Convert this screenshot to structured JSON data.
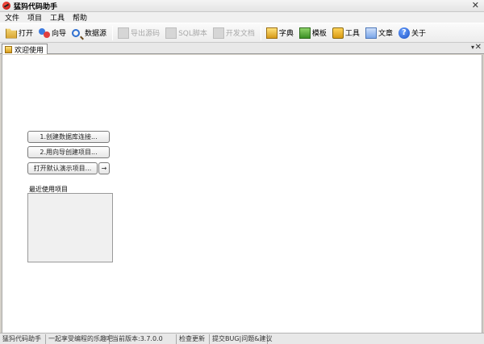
{
  "window": {
    "title": "猛犸代码助手",
    "close_glyph": "✕"
  },
  "menu": [
    "文件",
    "项目",
    "工具",
    "帮助"
  ],
  "toolbar": {
    "open": "打开",
    "wizard": "向导",
    "database": "数据源",
    "export_source": "导出源码",
    "sql_script": "SQL脚本",
    "dev_docs": "开发文档",
    "dictionary": "字典",
    "template": "模板",
    "tools": "工具",
    "article": "文章",
    "about": "关于"
  },
  "tabs": {
    "welcome": "欢迎使用",
    "arrow_glyph": "▾",
    "close_glyph": "✕"
  },
  "welcome": {
    "create_db": "1.创建数据库连接...",
    "wizard_project": "2.用向导创建项目...",
    "open_demo": "打开默认演示项目...",
    "go_glyph": "→",
    "recent_label": "最近使用项目"
  },
  "status": {
    "app": "猛犸代码助手",
    "slogan": "一起享受编程的乐趣吧",
    "version": "当前版本:3.7.0.0",
    "check_update": "检查更新",
    "report_bug": "提交BUG|问题&建议"
  }
}
